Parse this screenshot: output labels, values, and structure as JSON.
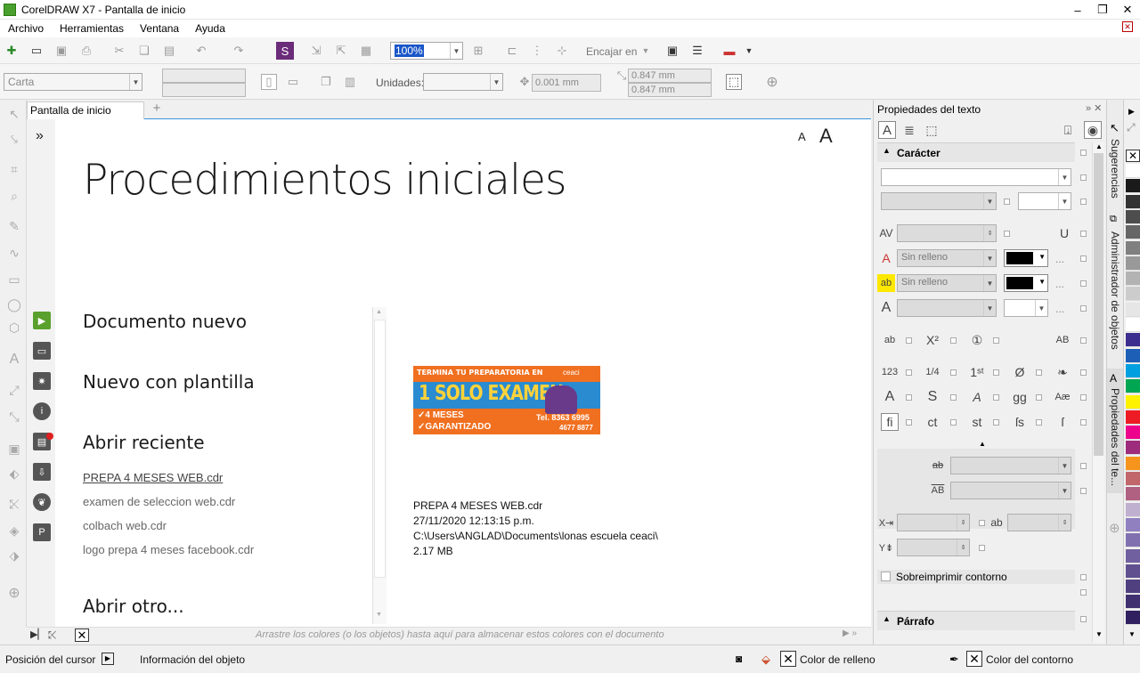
{
  "window": {
    "title": "CorelDRAW X7 - Pantalla de inicio",
    "minimize": "–",
    "restore": "❐",
    "close": "✕"
  },
  "menu": [
    "Archivo",
    "Herramientas",
    "Ventana",
    "Ayuda"
  ],
  "toolbar1": {
    "zoom": "100%",
    "fit_label": "Encajar en"
  },
  "toolbar2": {
    "page_size": "Carta",
    "units_label": "Unidades:",
    "nudge": "0.001 mm",
    "dup_x": "0.847 mm",
    "dup_y": "0.847 mm"
  },
  "tabs": {
    "welcome": "Pantalla de inicio",
    "add": "+"
  },
  "welcome": {
    "expand": "»",
    "title": "Procedimientos iniciales",
    "font_small": "A",
    "font_big": "A",
    "new_doc": "Documento nuevo",
    "from_template": "Nuevo con plantilla",
    "open_recent": "Abrir reciente",
    "recent_files": [
      "PREPA 4 MESES WEB.cdr",
      "examen de seleccion web.cdr",
      "colbach web.cdr",
      "logo prepa 4 meses facebook.cdr"
    ],
    "open_other": "Abrir otro...",
    "preview": {
      "banner_top": "TERMINA TU PREPARATORIA EN",
      "banner_main": "1 SOLO EXAMEN",
      "banner_line1": "✓4 MESES",
      "banner_line2": "✓GARANTIZADO",
      "banner_phone1": "Tel. 8363 6995",
      "banner_phone2": "4677 8877",
      "banner_brand": "ceaci"
    },
    "file_info": {
      "name": "PREPA 4 MESES WEB.cdr",
      "date": "27/11/2020 12:13:15 p.m.",
      "path": "C:\\Users\\ANGLAD\\Documents\\lonas escuela ceaci\\",
      "size": "2.17 MB"
    }
  },
  "palette_hint": "Arrastre los colores (o los objetos) hasta aquí para almacenar estos colores con el documento",
  "status": {
    "cursor_pos": "Posición del cursor",
    "object_info": "Información del objeto",
    "fill": "Color de relleno",
    "outline": "Color del contorno"
  },
  "docker": {
    "title": "Propiedades del texto",
    "character": "Carácter",
    "no_fill_1": "Sin relleno",
    "no_fill_2": "Sin relleno",
    "overprint": "Sobreimprimir contorno",
    "paragraph": "Párrafo",
    "ellipsis": "..."
  },
  "side_tabs": {
    "hints": "Sugerencias",
    "obj_manager": "Administrador de objetos",
    "text_props": "Propiedades del te..."
  },
  "colors": {
    "accent_blue": "#3a94e0",
    "green_play": "#5aa02c",
    "swatches": [
      "#ffffff",
      "#1a1a1a",
      "#333333",
      "#4d4d4d",
      "#666666",
      "#808080",
      "#999999",
      "#b3b3b3",
      "#cccccc",
      "#e6e6e6",
      "#ffffff",
      "#3b2e8e",
      "#1d5fb7",
      "#00a0e0",
      "#00a651",
      "#fff200",
      "#ed1c24",
      "#ec008c",
      "#9e2c7c",
      "#f7941d",
      "#c1666b",
      "#b06080",
      "#c0b0d0",
      "#9080c0",
      "#8070b0",
      "#7060a0",
      "#605090",
      "#504080",
      "#403070",
      "#302060"
    ]
  }
}
